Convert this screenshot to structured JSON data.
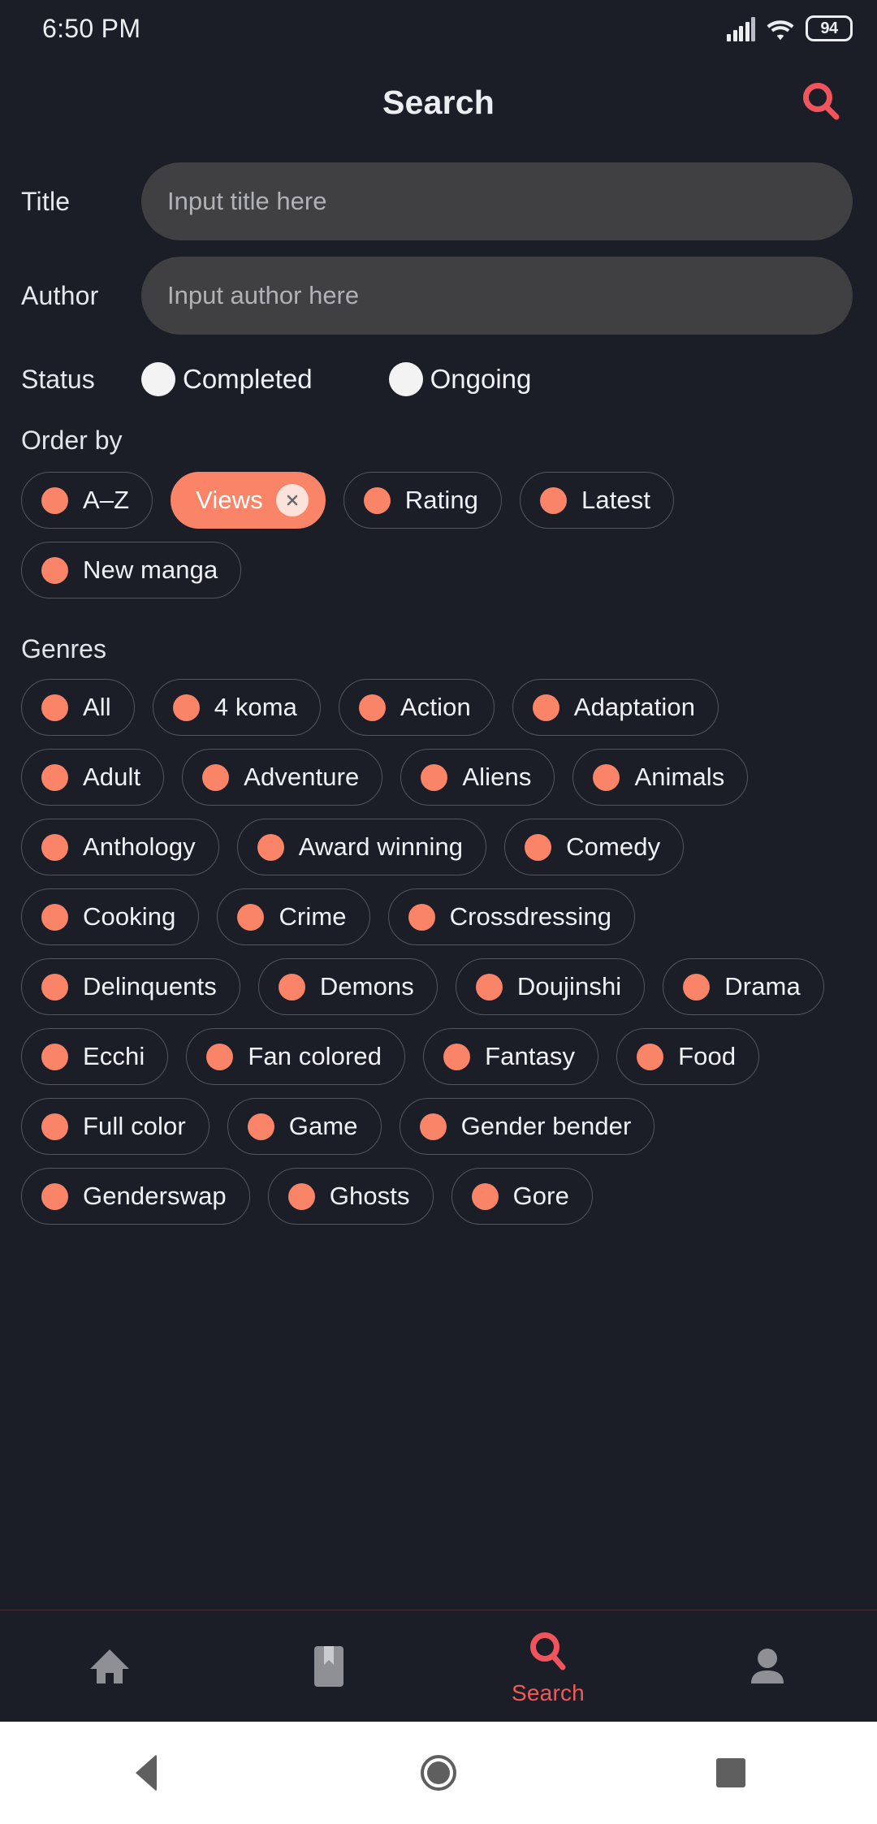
{
  "status_bar": {
    "time": "6:50 PM",
    "battery": "94",
    "icons": [
      "signal-icon",
      "wifi-icon",
      "battery-icon"
    ]
  },
  "app_bar": {
    "title": "Search",
    "action_icon": "search-icon"
  },
  "form": {
    "title": {
      "label": "Title",
      "value": "",
      "placeholder": "Input title here"
    },
    "author": {
      "label": "Author",
      "value": "",
      "placeholder": "Input author here"
    },
    "status": {
      "label": "Status",
      "options": [
        {
          "label": "Completed",
          "selected": false
        },
        {
          "label": "Ongoing",
          "selected": false
        }
      ]
    }
  },
  "order_by": {
    "heading": "Order by",
    "chips": [
      {
        "label": "A–Z",
        "selected": false
      },
      {
        "label": "Views",
        "selected": true
      },
      {
        "label": "Rating",
        "selected": false
      },
      {
        "label": "Latest",
        "selected": false
      },
      {
        "label": "New manga",
        "selected": false
      }
    ]
  },
  "genres": {
    "heading": "Genres",
    "chips": [
      {
        "label": "All",
        "selected": false
      },
      {
        "label": "4 koma",
        "selected": false
      },
      {
        "label": "Action",
        "selected": false
      },
      {
        "label": "Adaptation",
        "selected": false
      },
      {
        "label": "Adult",
        "selected": false
      },
      {
        "label": "Adventure",
        "selected": false
      },
      {
        "label": "Aliens",
        "selected": false
      },
      {
        "label": "Animals",
        "selected": false
      },
      {
        "label": "Anthology",
        "selected": false
      },
      {
        "label": "Award winning",
        "selected": false
      },
      {
        "label": "Comedy",
        "selected": false
      },
      {
        "label": "Cooking",
        "selected": false
      },
      {
        "label": "Crime",
        "selected": false
      },
      {
        "label": "Crossdressing",
        "selected": false
      },
      {
        "label": "Delinquents",
        "selected": false
      },
      {
        "label": "Demons",
        "selected": false
      },
      {
        "label": "Doujinshi",
        "selected": false
      },
      {
        "label": "Drama",
        "selected": false
      },
      {
        "label": "Ecchi",
        "selected": false
      },
      {
        "label": "Fan colored",
        "selected": false
      },
      {
        "label": "Fantasy",
        "selected": false
      },
      {
        "label": "Food",
        "selected": false
      },
      {
        "label": "Full color",
        "selected": false
      },
      {
        "label": "Game",
        "selected": false
      },
      {
        "label": "Gender bender",
        "selected": false
      },
      {
        "label": "Genderswap",
        "selected": false
      },
      {
        "label": "Ghosts",
        "selected": false
      },
      {
        "label": "Gore",
        "selected": false
      }
    ]
  },
  "bottom_nav": {
    "items": [
      {
        "icon": "home-icon",
        "label": "",
        "active": false
      },
      {
        "icon": "bookmark-icon",
        "label": "",
        "active": false
      },
      {
        "icon": "search-icon",
        "label": "Search",
        "active": true
      },
      {
        "icon": "person-icon",
        "label": "",
        "active": false
      }
    ]
  },
  "android_nav": {
    "buttons": [
      "back-icon",
      "home-icon",
      "recents-icon"
    ]
  },
  "colors": {
    "background": "#1b1d27",
    "accent": "#fa8468",
    "accent_active": "#f05a5a",
    "input_background": "#403f41",
    "chip_border": "#53555f",
    "text_primary": "#eceef2"
  }
}
